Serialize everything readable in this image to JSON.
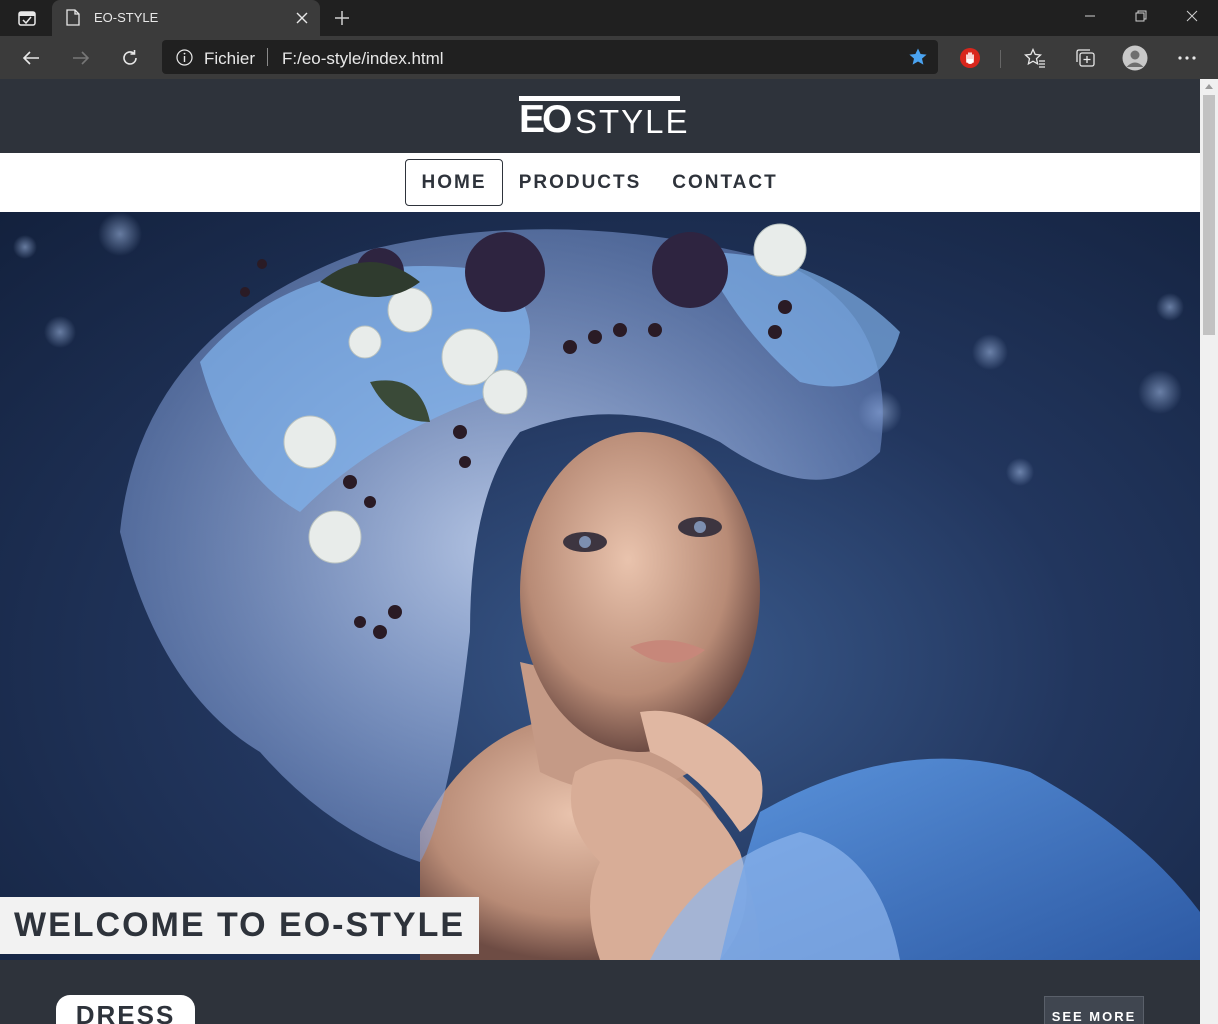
{
  "browser": {
    "tab_title": "EO-STYLE",
    "address_scheme": "Fichier",
    "address_url": "F:/eo-style/index.html"
  },
  "site": {
    "logo_text_bold": "EO",
    "logo_text_light": "STYLE",
    "nav": [
      {
        "label": "HOME",
        "active": true
      },
      {
        "label": "PRODUCTS",
        "active": false
      },
      {
        "label": "CONTACT",
        "active": false
      }
    ],
    "hero_caption": "WELCOME TO EO-STYLE",
    "section_title": "DRESS",
    "see_more_label": "SEE MORE"
  },
  "colors": {
    "header_bg": "#2e333b",
    "nav_bg": "#ffffff",
    "nav_text": "#2e333b",
    "accent_star": "#4aa3f0",
    "extension_red": "#d9261c"
  },
  "icons": {
    "tab_actions": "tab-actions-icon",
    "favicon": "page-icon",
    "close": "close-icon",
    "new_tab": "plus-icon",
    "back": "back-arrow-icon",
    "forward": "forward-arrow-icon",
    "refresh": "refresh-icon",
    "info": "info-icon",
    "favorite": "star-icon",
    "extension": "stop-hand-icon",
    "favorites": "favorites-icon",
    "collections": "collections-icon",
    "profile": "profile-icon",
    "menu": "more-icon"
  }
}
